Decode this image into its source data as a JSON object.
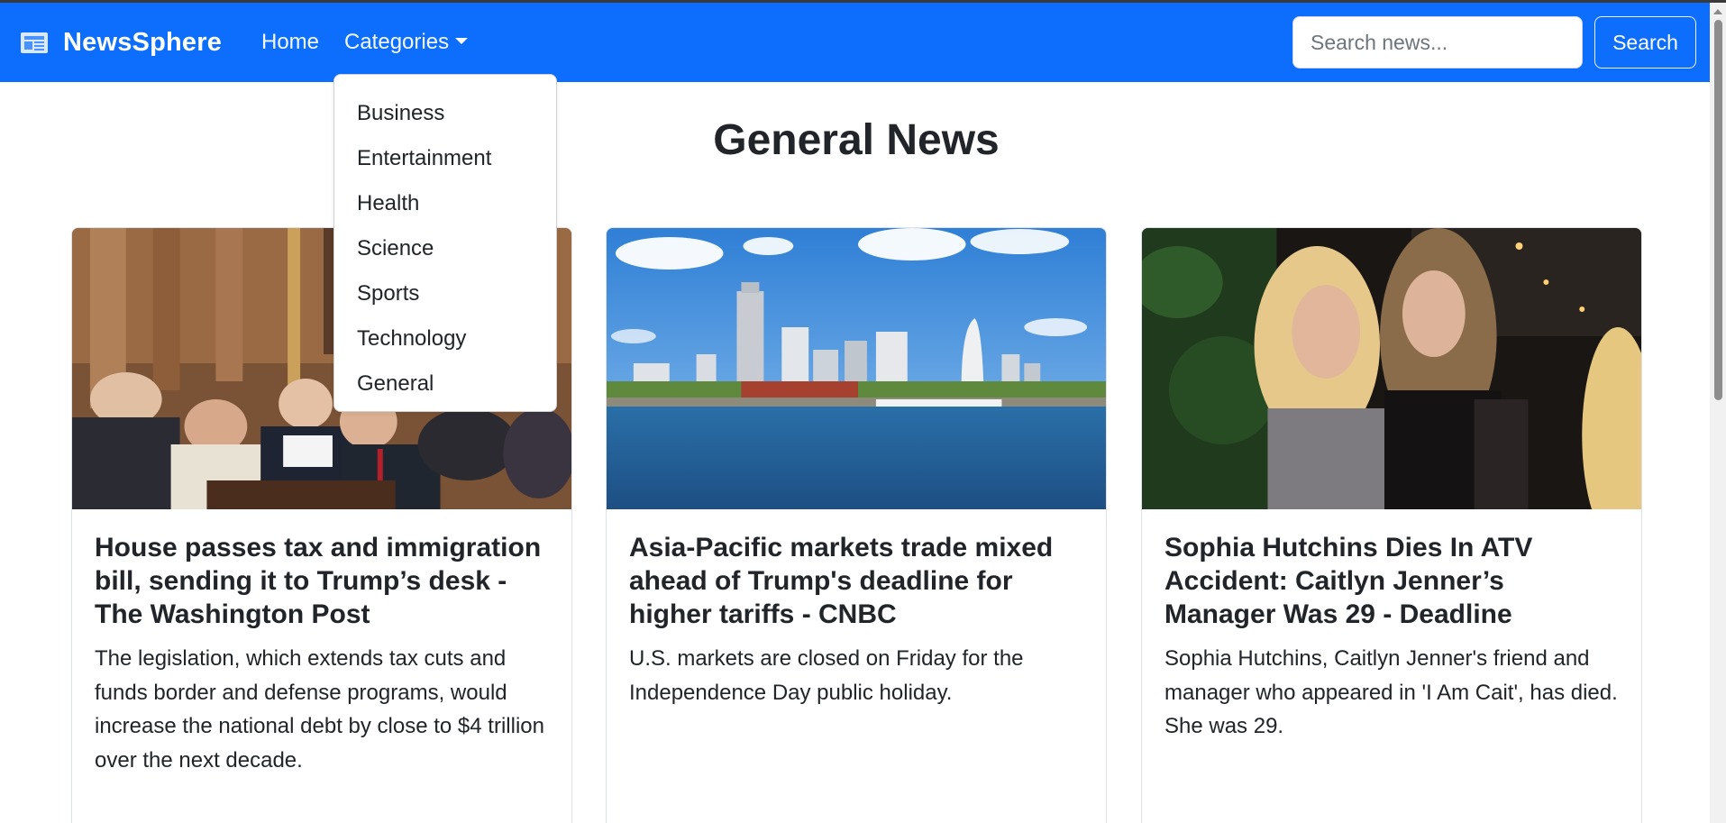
{
  "navbar": {
    "brand_icon": "newspaper-icon",
    "brand": "NewsSphere",
    "links": [
      {
        "label": "Home"
      },
      {
        "label": "Categories",
        "icon": "caret-down-icon"
      }
    ],
    "search": {
      "placeholder": "Search news...",
      "value": "",
      "button_label": "Search"
    },
    "color": "#0d6efd"
  },
  "dropdown": {
    "items": [
      "Business",
      "Entertainment",
      "Health",
      "Science",
      "Sports",
      "Technology",
      "General"
    ]
  },
  "main": {
    "title": "General News",
    "articles": [
      {
        "image": "photo-capitol-bill-signing",
        "title": "House passes tax and immigration bill, sending it to Trump’s desk - The Washington Post",
        "description": "The legislation, which extends tax cuts and funds border and defense programs, would increase the national debt by close to $4 trillion over the next decade."
      },
      {
        "image": "photo-yokohama-skyline",
        "title": "Asia-Pacific markets trade mixed ahead of Trump's deadline for higher tariffs - CNBC",
        "description": "U.S. markets are closed on Friday for the Independence Day public holiday."
      },
      {
        "image": "photo-two-women-portrait",
        "title": "Sophia Hutchins Dies In ATV Accident: Caitlyn Jenner’s Manager Was 29 - Deadline",
        "description": "Sophia Hutchins, Caitlyn Jenner's friend and manager who appeared in 'I Am Cait', has died. She was 29."
      }
    ]
  }
}
